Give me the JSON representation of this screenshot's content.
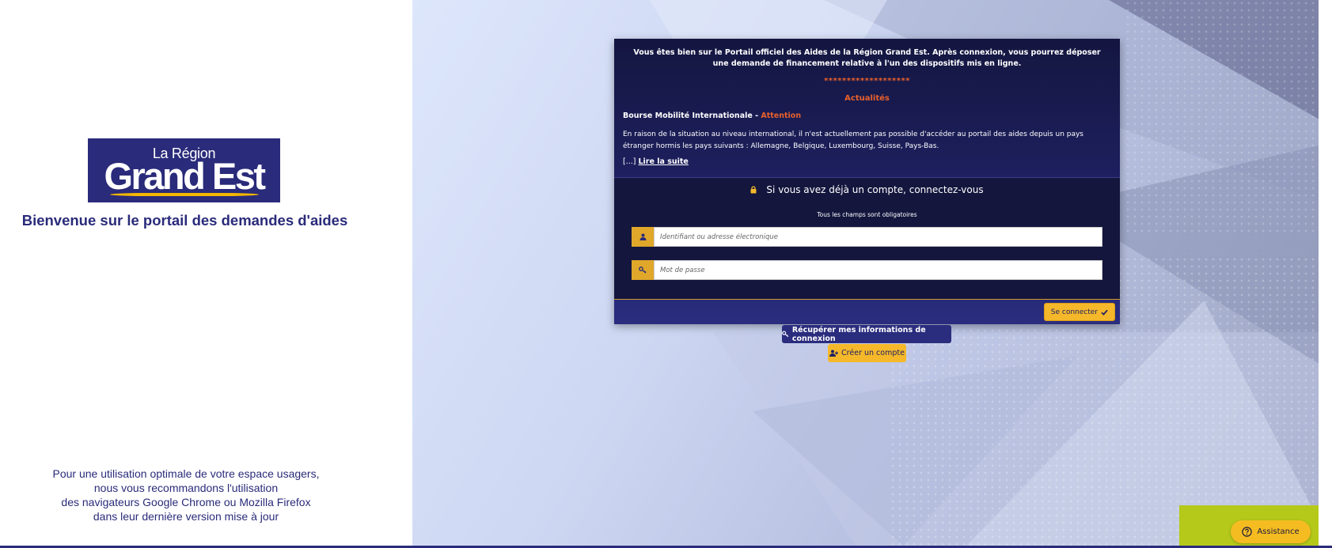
{
  "left": {
    "logo": {
      "line1": "La Région",
      "line2": "Grand Est"
    },
    "welcome": "Bienvenue sur le portail des demandes d'aides",
    "browser_note": [
      "Pour une utilisation optimale de votre espace usagers,",
      "nous vous recommandons l'utilisation",
      "des navigateurs Google Chrome ou Mozilla Firefox",
      "dans leur dernière version mise à jour"
    ]
  },
  "card": {
    "info": "Vous êtes bien sur le Portail officiel des Aides de la Région Grand Est. Après connexion, vous pourrez déposer une demande de financement relative à l'un des dispositifs mis en ligne.",
    "stars": "*******************",
    "news_title": "Actualités",
    "news_heading": "Bourse Mobilité Internationale - ",
    "news_attention": "Attention",
    "news_body": "En raison de la situation au niveau international, il n'est actuellement pas possible d'accéder au portail des aides depuis un pays étranger hormis les pays suivants : Allemagne, Belgique, Luxembourg, Suisse, Pays-Bas.",
    "read_more_prefix": "[...] ",
    "read_more_link": "Lire la suite",
    "login_title": "Si vous avez déjà un compte, connectez-vous",
    "required_note": "Tous les champs sont obligatoires",
    "username_placeholder": "Identifiant ou adresse électronique",
    "password_placeholder": "Mot de passe",
    "login_button": "Se connecter"
  },
  "actions": {
    "recover": "Récupérer mes informations de connexion",
    "create": "Créer un compte",
    "assistance": "Assistance"
  },
  "colors": {
    "brand_navy": "#2a2b7a",
    "accent_yellow": "#f5b82a",
    "accent_orange": "#e8612c",
    "assist_green": "#b5c91a"
  },
  "icons": [
    "lock-icon",
    "user-icon",
    "key-icon",
    "check-icon",
    "user-plus-icon",
    "question-circle-icon"
  ]
}
